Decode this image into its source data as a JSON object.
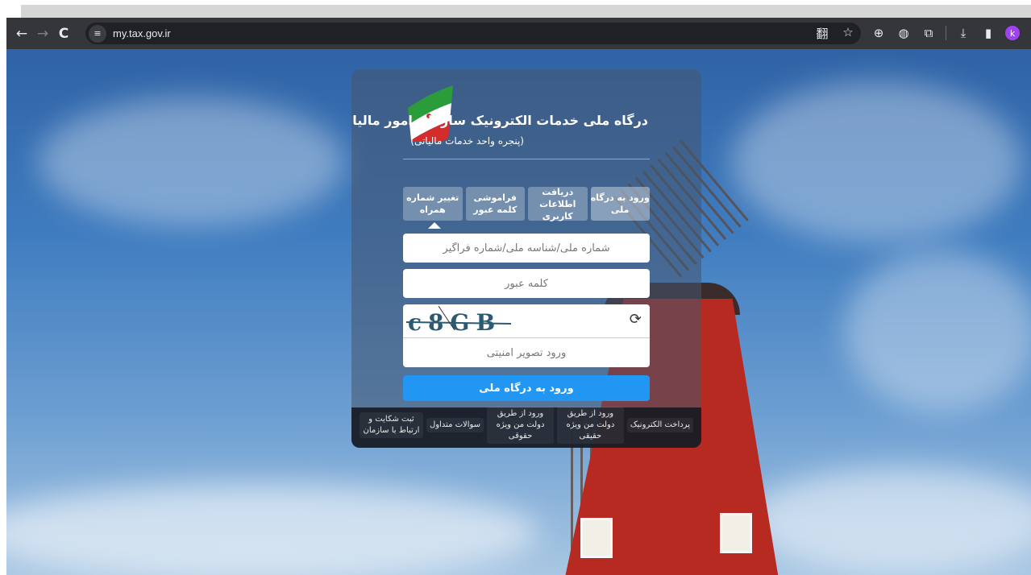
{
  "browser": {
    "url": "my.tax.gov.ir",
    "nav": {
      "back_icon": "←",
      "forward_icon": "→",
      "reload_icon": "C"
    },
    "site_info_icon": "≡",
    "omnibox_icons": {
      "translate_icon": "翻",
      "bookmark_icon": "☆"
    },
    "toolbar_icons": {
      "extension1_icon": "⊕",
      "extension2_icon": "◍",
      "extensions_icon": "⧉",
      "download_icon": "⤓",
      "sidepanel_icon": "▮",
      "avatar_letter": "k"
    }
  },
  "portal": {
    "title": "درگاه ملی خدمات الکترونیک سازمان امور مالیاتی",
    "subtitle": "(پنجره واحد خدمات مالیاتی)",
    "tabs": [
      {
        "label": "ورود به درگاه ملی",
        "active": true
      },
      {
        "label": "دریافت اطلاعات کاربری",
        "active": false
      },
      {
        "label": "فراموشی کلمه عبور",
        "active": false
      },
      {
        "label": "تغییر شماره همراه",
        "active": false
      }
    ],
    "username_placeholder": "شماره ملی/شناسه ملی/شماره فراگیر",
    "password_placeholder": "کلمه عبور",
    "captcha_text": "c8GB",
    "captcha_refresh_icon": "⟳",
    "captcha_placeholder": "ورود تصویر امنیتی",
    "login_button": "ورود به درگاه ملی",
    "footer_links": [
      "پرداخت الکترونیک",
      "ورود از طریق دولت من ویژه حقیقی",
      "ورود از طریق دولت من ویژه حقوقی",
      "سوالات متداول",
      "ثبت شکایت و ارتباط با سازمان"
    ]
  },
  "colors": {
    "chrome_bg": "#35363a",
    "omnibox_bg": "#202124",
    "login_button": "#2196f3",
    "avatar": "#a142f4",
    "windmill_red": "#b62a22"
  }
}
